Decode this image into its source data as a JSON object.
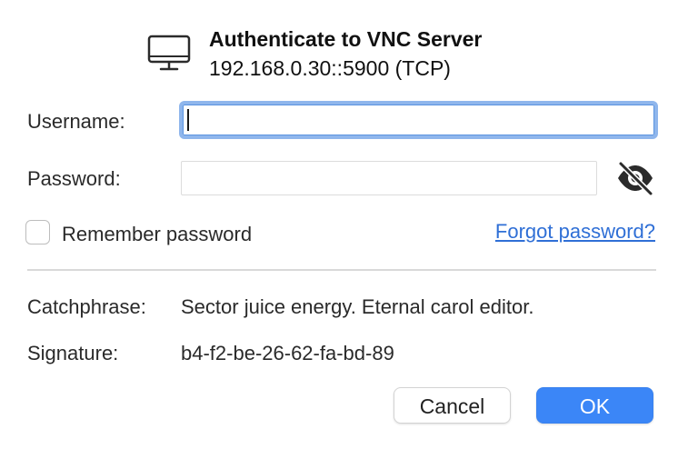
{
  "dialog": {
    "title": "Authenticate to VNC Server",
    "subtitle": "192.168.0.30::5900 (TCP)",
    "icon": "monitor-icon"
  },
  "form": {
    "username_label": "Username:",
    "username_value": "",
    "password_label": "Password:",
    "password_value": "",
    "password_toggle_icon": "eye-slash-icon",
    "remember_label": "Remember password",
    "remember_checked": false,
    "forgot_link": "Forgot password?"
  },
  "info": {
    "catchphrase_label": "Catchphrase:",
    "catchphrase_value": "Sector juice energy. Eternal carol editor.",
    "signature_label": "Signature:",
    "signature_value": "b4-f2-be-26-62-fa-bd-89"
  },
  "buttons": {
    "cancel": "Cancel",
    "ok": "OK"
  },
  "colors": {
    "accent": "#3b86f7",
    "link": "#2f6fd6",
    "focus_ring": "#8fb6ec"
  }
}
